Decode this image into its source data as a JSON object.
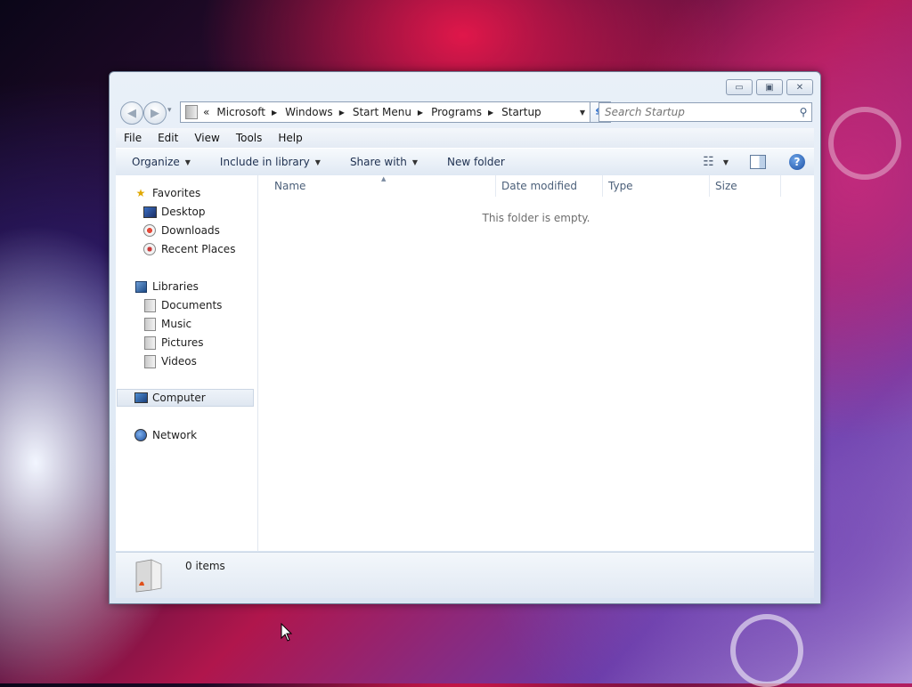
{
  "window": {
    "caption_buttons": {
      "minimize": "▭",
      "maximize": "▣",
      "close": "✕"
    }
  },
  "navigation": {
    "back_glyph": "◀",
    "forward_glyph": "▶",
    "history_glyph": "▾",
    "breadcrumb_overflow": "«",
    "breadcrumb": [
      "Microsoft",
      "Windows",
      "Start Menu",
      "Programs",
      "Startup"
    ],
    "breadcrumb_separator": "▶",
    "address_dropdown": "▼",
    "refresh_glyph": "⇆",
    "search_placeholder": "Search Startup",
    "search_glyph": "⚲"
  },
  "menubar": [
    "File",
    "Edit",
    "View",
    "Tools",
    "Help"
  ],
  "toolbar": {
    "organize": "Organize",
    "include_in_library": "Include in library",
    "share_with": "Share with",
    "new_folder": "New folder",
    "dropdown_glyph": "▼",
    "views_glyph": "☷",
    "help_glyph": "?"
  },
  "nav_pane": {
    "favorites": {
      "label": "Favorites",
      "items": [
        "Desktop",
        "Downloads",
        "Recent Places"
      ]
    },
    "libraries": {
      "label": "Libraries",
      "items": [
        "Documents",
        "Music",
        "Pictures",
        "Videos"
      ]
    },
    "computer": "Computer",
    "network": "Network"
  },
  "columns": [
    "Name",
    "Date modified",
    "Type",
    "Size"
  ],
  "sort_indicator": "▲",
  "empty_message": "This folder is empty.",
  "details_pane": {
    "item_count": "0 items"
  },
  "colors": {
    "accent": "#2a6bc8",
    "window_frame": "#dbe6f3",
    "toolbar_text": "#1e3050",
    "column_header_text": "#4c607a"
  }
}
